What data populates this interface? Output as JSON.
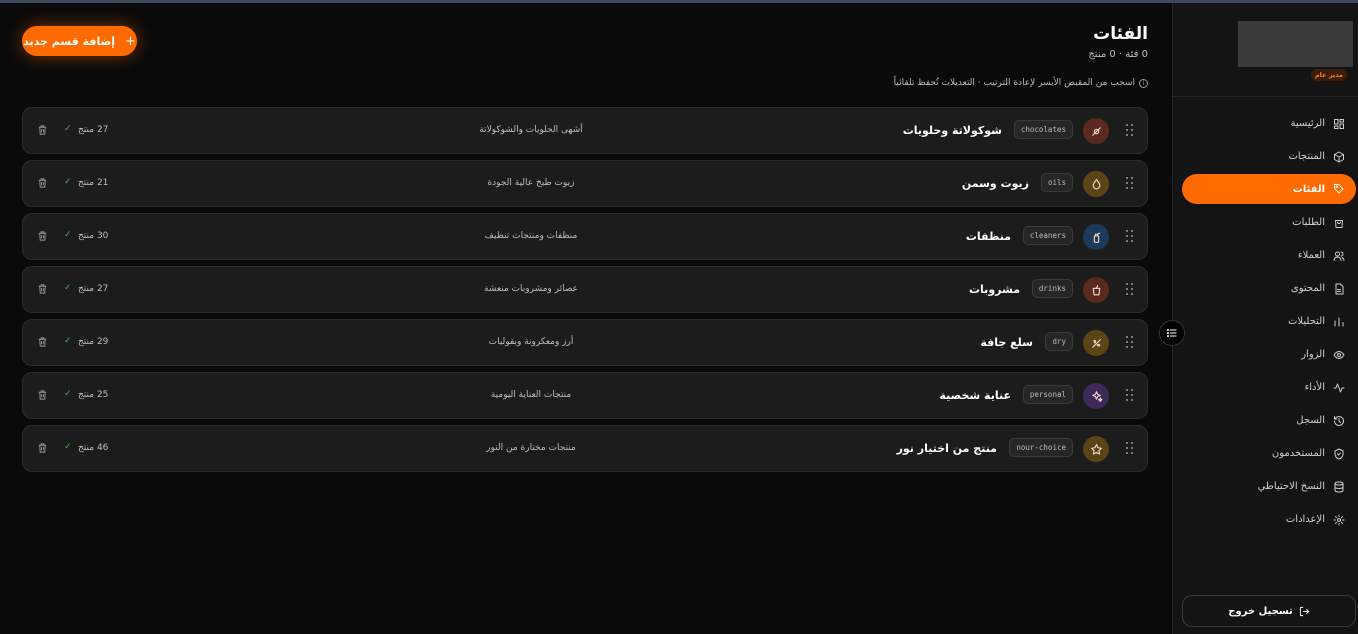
{
  "header": {
    "title": "الفئات",
    "subtitle": "0 فئة · 0 منتج",
    "hint": "اسحب من المقبض الأيسر لإعادة الترتيب · التعديلات تُحفظ تلقائياً",
    "add_label": "إضافة قسم جديد"
  },
  "categories": [
    {
      "name": "شوكولاتة وحلويات",
      "slug": "chocolates",
      "desc": "أشهى الحلويات والشوكولاتة",
      "count": "27 منتج",
      "icon": "candy-icon",
      "color": "#5a2a20"
    },
    {
      "name": "زيوت وسمن",
      "slug": "oils",
      "desc": "زيوت طبخ عالية الجودة",
      "count": "21 منتج",
      "icon": "droplet-icon",
      "color": "#5a4516"
    },
    {
      "name": "منظفات",
      "slug": "cleaners",
      "desc": "منظفات ومنتجات تنظيف",
      "count": "30 منتج",
      "icon": "spray-bottle-icon",
      "color": "#1e3a5a"
    },
    {
      "name": "مشروبات",
      "slug": "drinks",
      "desc": "عصائر ومشروبات منعشة",
      "count": "27 منتج",
      "icon": "cup-icon",
      "color": "#5a2a20"
    },
    {
      "name": "سلع جافة",
      "slug": "dry",
      "desc": "أرز ومعكرونة وبقوليات",
      "count": "29 منتج",
      "icon": "wheat-icon",
      "color": "#5a4516"
    },
    {
      "name": "عناية شخصية",
      "slug": "personal",
      "desc": "منتجات العناية اليومية",
      "count": "25 منتج",
      "icon": "sparkles-icon",
      "color": "#3e2a5a"
    },
    {
      "name": "منتج من اختيار نور",
      "slug": "nour-choice",
      "desc": "منتجات مختارة من النور",
      "count": "46 منتج",
      "icon": "star-icon",
      "color": "#5a4516"
    }
  ],
  "sidebar": {
    "role": "مدير عام",
    "items": [
      {
        "label": "الرئيسية",
        "icon": "dashboard-icon"
      },
      {
        "label": "المنتجات",
        "icon": "package-icon"
      },
      {
        "label": "الفئات",
        "icon": "tag-icon",
        "active": true
      },
      {
        "label": "الطلبات",
        "icon": "shopping-bag-icon"
      },
      {
        "label": "العملاء",
        "icon": "users-icon"
      },
      {
        "label": "المحتوى",
        "icon": "document-icon"
      },
      {
        "label": "التحليلات",
        "icon": "bar-chart-icon"
      },
      {
        "label": "الزوار",
        "icon": "eye-icon"
      },
      {
        "label": "الأداء",
        "icon": "activity-icon"
      },
      {
        "label": "السجل",
        "icon": "history-icon"
      },
      {
        "label": "المستخدمون",
        "icon": "shield-icon"
      },
      {
        "label": "النسخ الاحتياطي",
        "icon": "database-icon"
      },
      {
        "label": "الإعدادات",
        "icon": "gear-icon"
      }
    ],
    "logout_label": "تسجيل خروج"
  },
  "colors": {
    "accent": "#ff6a00",
    "background": "#0a0a0a",
    "card": "#1c1c1c",
    "sidebar": "#141414"
  }
}
